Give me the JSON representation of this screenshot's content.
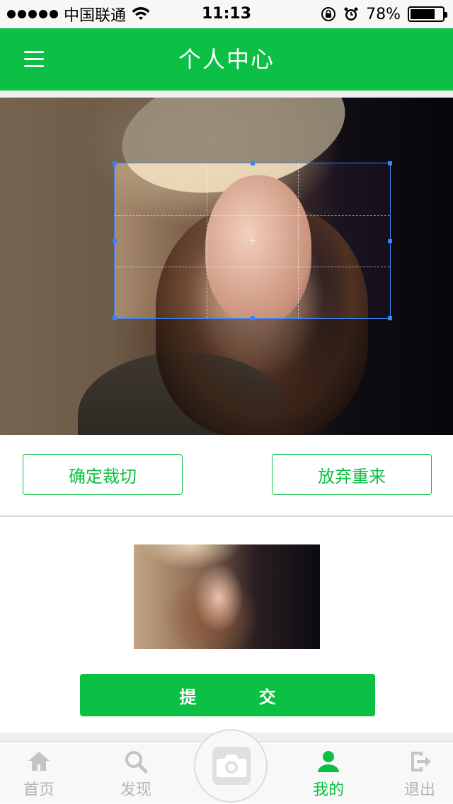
{
  "status_bar": {
    "carrier": "中国联通",
    "time": "11:13",
    "battery_percent": "78%",
    "battery_level": 0.78
  },
  "nav": {
    "title": "个人中心",
    "menu_icon": "hamburger-menu-icon"
  },
  "crop": {
    "confirm_label": "确定裁切",
    "reset_label": "放弃重来"
  },
  "submit_label": "提 交",
  "tab_bar": {
    "items": [
      {
        "label": "首页",
        "icon": "home-icon",
        "active": false
      },
      {
        "label": "发现",
        "icon": "search-icon",
        "active": false
      },
      {
        "label": "我的",
        "icon": "user-icon",
        "active": true
      },
      {
        "label": "退出",
        "icon": "logout-icon",
        "active": false
      }
    ],
    "center_icon": "camera-icon"
  },
  "colors": {
    "brand": "#0cc045",
    "crop_border": "#3b82f6",
    "inactive_tab": "#b5b5b5"
  }
}
